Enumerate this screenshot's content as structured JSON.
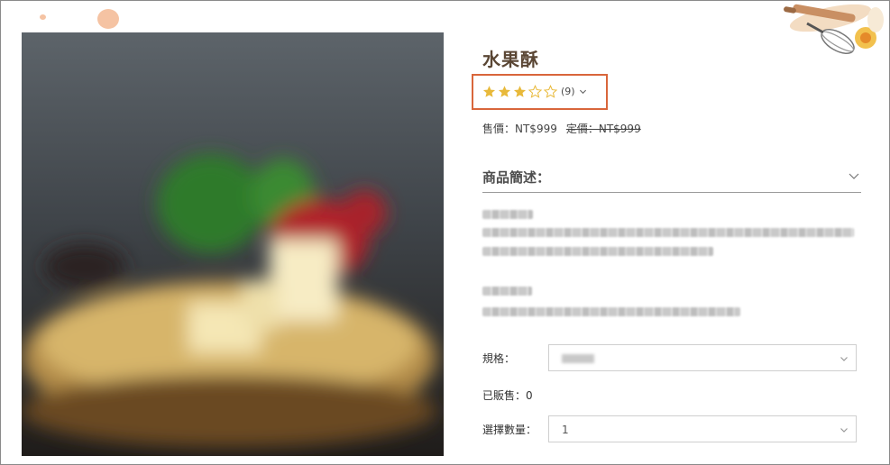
{
  "product": {
    "title": "水果酥",
    "rating": {
      "stars_filled": 3,
      "stars_total": 5,
      "count_label": "(9)"
    },
    "price_label": "售價：NT$999",
    "list_price_label": "定價：NT$999",
    "description_heading": "商品簡述：",
    "spec_label": "規格：",
    "spec_value": "",
    "sold_label": "已販售：0",
    "qty_label": "選擇數量：",
    "qty_value": "1"
  },
  "colors": {
    "accent_box": "#d9663b",
    "star_filled": "#e8b93a",
    "star_empty": "#e8b93a",
    "title": "#5a4634"
  },
  "icons": {
    "rating_dropdown": "chevron-down-icon",
    "section_toggle": "chevron-down-icon",
    "select_arrow": "chevron-down-icon"
  }
}
